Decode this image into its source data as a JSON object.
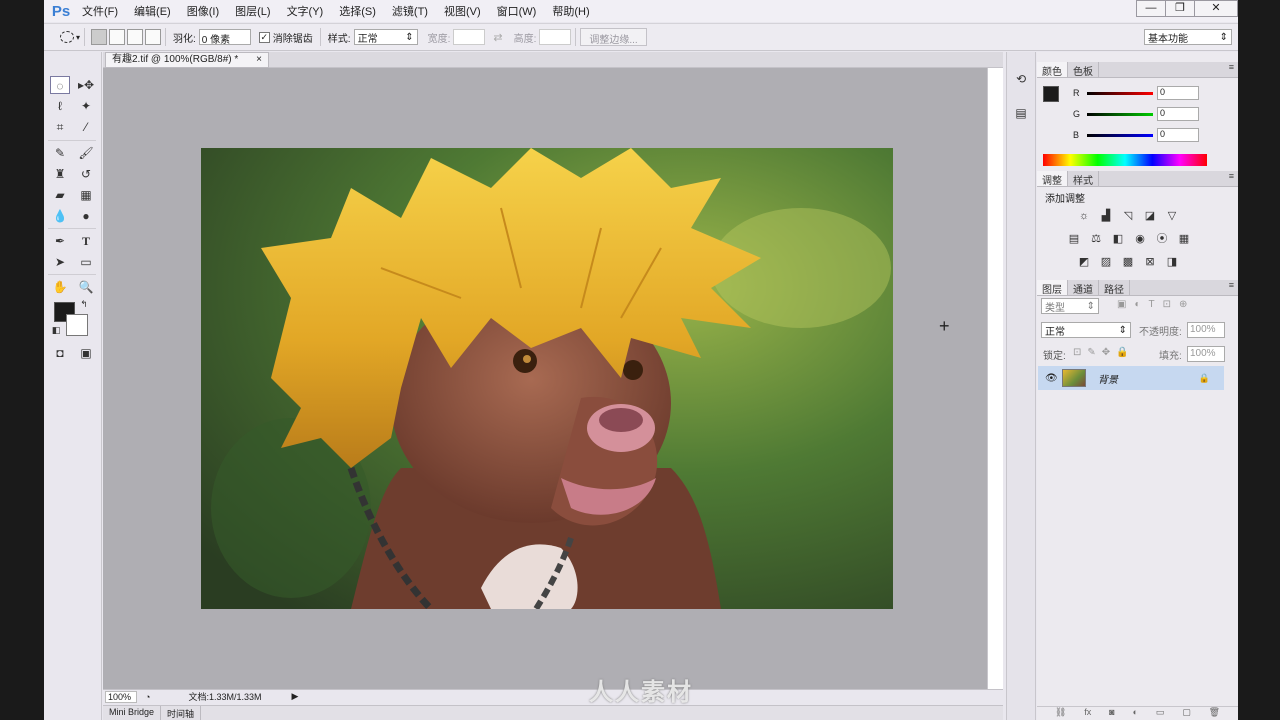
{
  "app": {
    "logo": "Ps"
  },
  "menubar": {
    "items": [
      "文件(F)",
      "编辑(E)",
      "图像(I)",
      "图层(L)",
      "文字(Y)",
      "选择(S)",
      "滤镜(T)",
      "视图(V)",
      "窗口(W)",
      "帮助(H)"
    ],
    "window_controls": {
      "minimize": "—",
      "restore": "❐",
      "close": "✕"
    }
  },
  "options_bar": {
    "feather_label": "羽化:",
    "feather_value": "0 像素",
    "antialias_label": "消除锯齿",
    "antialias_checked": true,
    "style_label": "样式:",
    "style_value": "正常",
    "width_label": "宽度:",
    "height_label": "高度:",
    "refine_edge": "调整边缘...",
    "workspace": "基本功能"
  },
  "document": {
    "tab_title": "有趣2.tif @ 100%(RGB/8#) *",
    "zoom": "100%",
    "doc_info": "文档:1.33M/1.33M"
  },
  "bottom_tabs": [
    "Mini Bridge",
    "时间轴"
  ],
  "color_panel": {
    "tabs": [
      "颜色",
      "色板"
    ],
    "r_label": "R",
    "g_label": "G",
    "b_label": "B",
    "r_value": "0",
    "g_value": "0",
    "b_value": "0",
    "foreground": "#1b1b1b"
  },
  "adjust_panel": {
    "tabs": [
      "调整",
      "样式"
    ],
    "title": "添加调整"
  },
  "layers_panel": {
    "tabs": [
      "图层",
      "通道",
      "路径"
    ],
    "kind_filter": "类型",
    "blend_mode": "正常",
    "opacity_label": "不透明度:",
    "opacity_value": "100%",
    "lock_label": "锁定:",
    "fill_label": "填充:",
    "fill_value": "100%",
    "layer_name": "背景"
  },
  "watermark": "人人素材"
}
